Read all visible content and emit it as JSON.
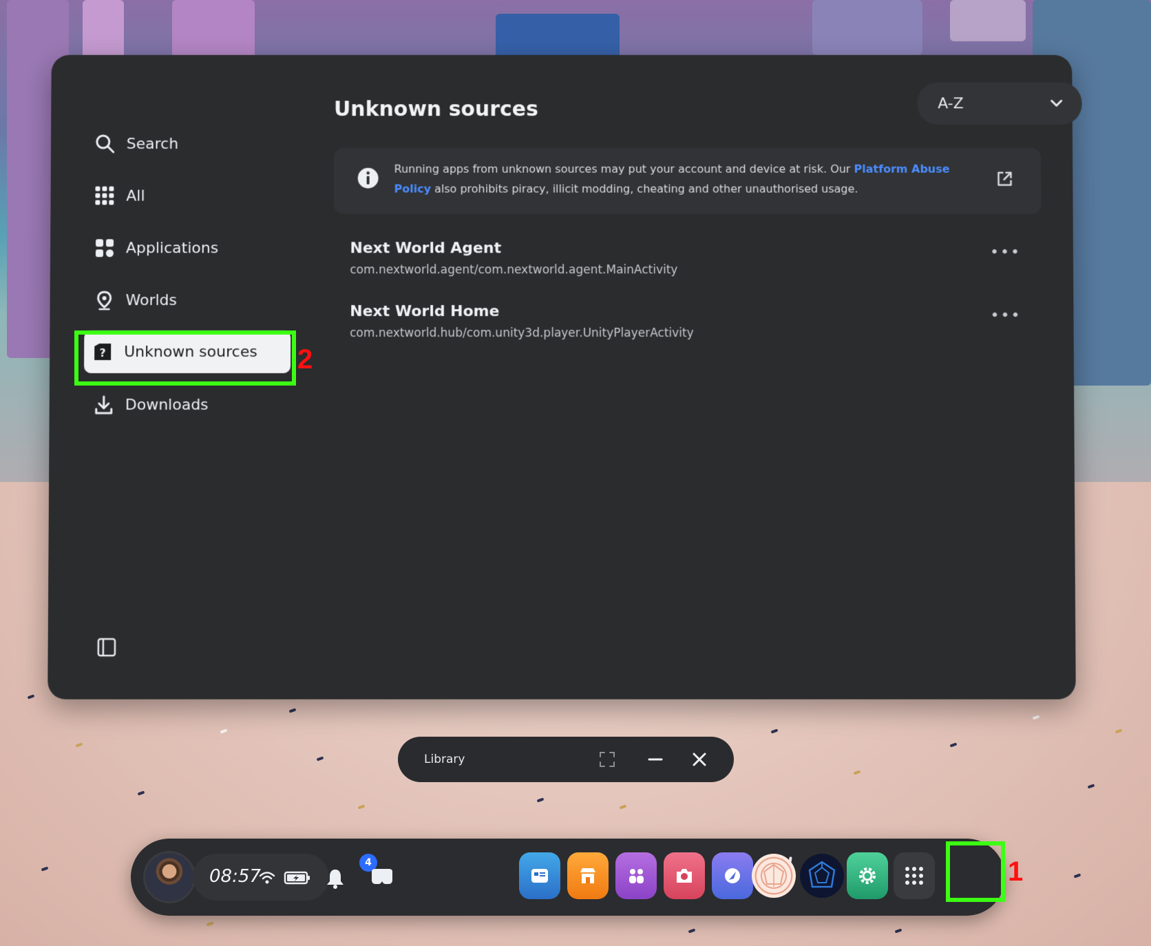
{
  "sidebar": {
    "items": [
      {
        "label": "Search",
        "icon": "search-icon"
      },
      {
        "label": "All",
        "icon": "grid-icon"
      },
      {
        "label": "Applications",
        "icon": "applications-icon"
      },
      {
        "label": "Worlds",
        "icon": "location-pin-icon"
      },
      {
        "label": "Unknown sources",
        "icon": "question-square-icon",
        "active": true
      },
      {
        "label": "Downloads",
        "icon": "download-icon"
      }
    ]
  },
  "main": {
    "title": "Unknown sources",
    "sort": {
      "value": "A-Z"
    },
    "warning": {
      "text_before": "Running apps from unknown sources may put your account and device at risk. Our ",
      "link": "Platform Abuse Policy",
      "text_after": " also prohibits piracy, illicit modding, cheating and other unauthorised usage."
    },
    "apps": [
      {
        "name": "Next World Agent",
        "package": "com.nextworld.agent/com.nextworld.agent.MainActivity",
        "more": "•••"
      },
      {
        "name": "Next World Home",
        "package": "com.nextworld.hub/com.unity3d.player.UnityPlayerActivity",
        "more": "•••"
      }
    ]
  },
  "window_bar": {
    "title": "Library"
  },
  "taskbar": {
    "time": "08:57",
    "notification_count": "4",
    "apps": [
      "Store listing",
      "Store",
      "People",
      "Camera",
      "Browser",
      "Orbit app",
      "Network app",
      "Settings",
      "App library"
    ]
  },
  "annotations": {
    "box1": "1",
    "box2": "2",
    "color": "#3cff14",
    "number_color": "#ff1010"
  },
  "colors": {
    "panel": "#2b2c2e",
    "link": "#4a8dff",
    "active_item_bg": "#f1f2f4"
  }
}
